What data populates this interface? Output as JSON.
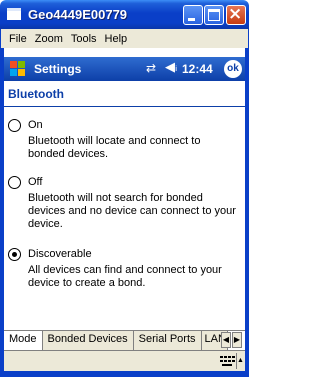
{
  "window": {
    "title": "Geo4449E00779"
  },
  "menu": {
    "items": [
      "File",
      "Zoom",
      "Tools",
      "Help"
    ]
  },
  "navbar": {
    "title": "Settings",
    "time": "12:44",
    "ok_label": "ok",
    "connectivity_icon": "connectivity-icon",
    "volume_icon": "volume-icon"
  },
  "page": {
    "title": "Bluetooth"
  },
  "options": [
    {
      "label": "On",
      "description": "Bluetooth will locate and connect to bonded devices.",
      "checked": false
    },
    {
      "label": "Off",
      "description": "Bluetooth will not search for bonded devices and no device can connect to your device.",
      "checked": false
    },
    {
      "label": "Discoverable",
      "description": "All devices can find and connect to your device to create a bond.",
      "checked": true
    }
  ],
  "tabs": [
    "Mode",
    "Bonded Devices",
    "Serial Ports",
    "LAN"
  ],
  "active_tab": "Mode",
  "colors": {
    "titlebar": "#0a3fc8",
    "navbar": "#0d3fa8",
    "accent_text": "#0d3fa8",
    "chrome": "#ece9d8"
  }
}
